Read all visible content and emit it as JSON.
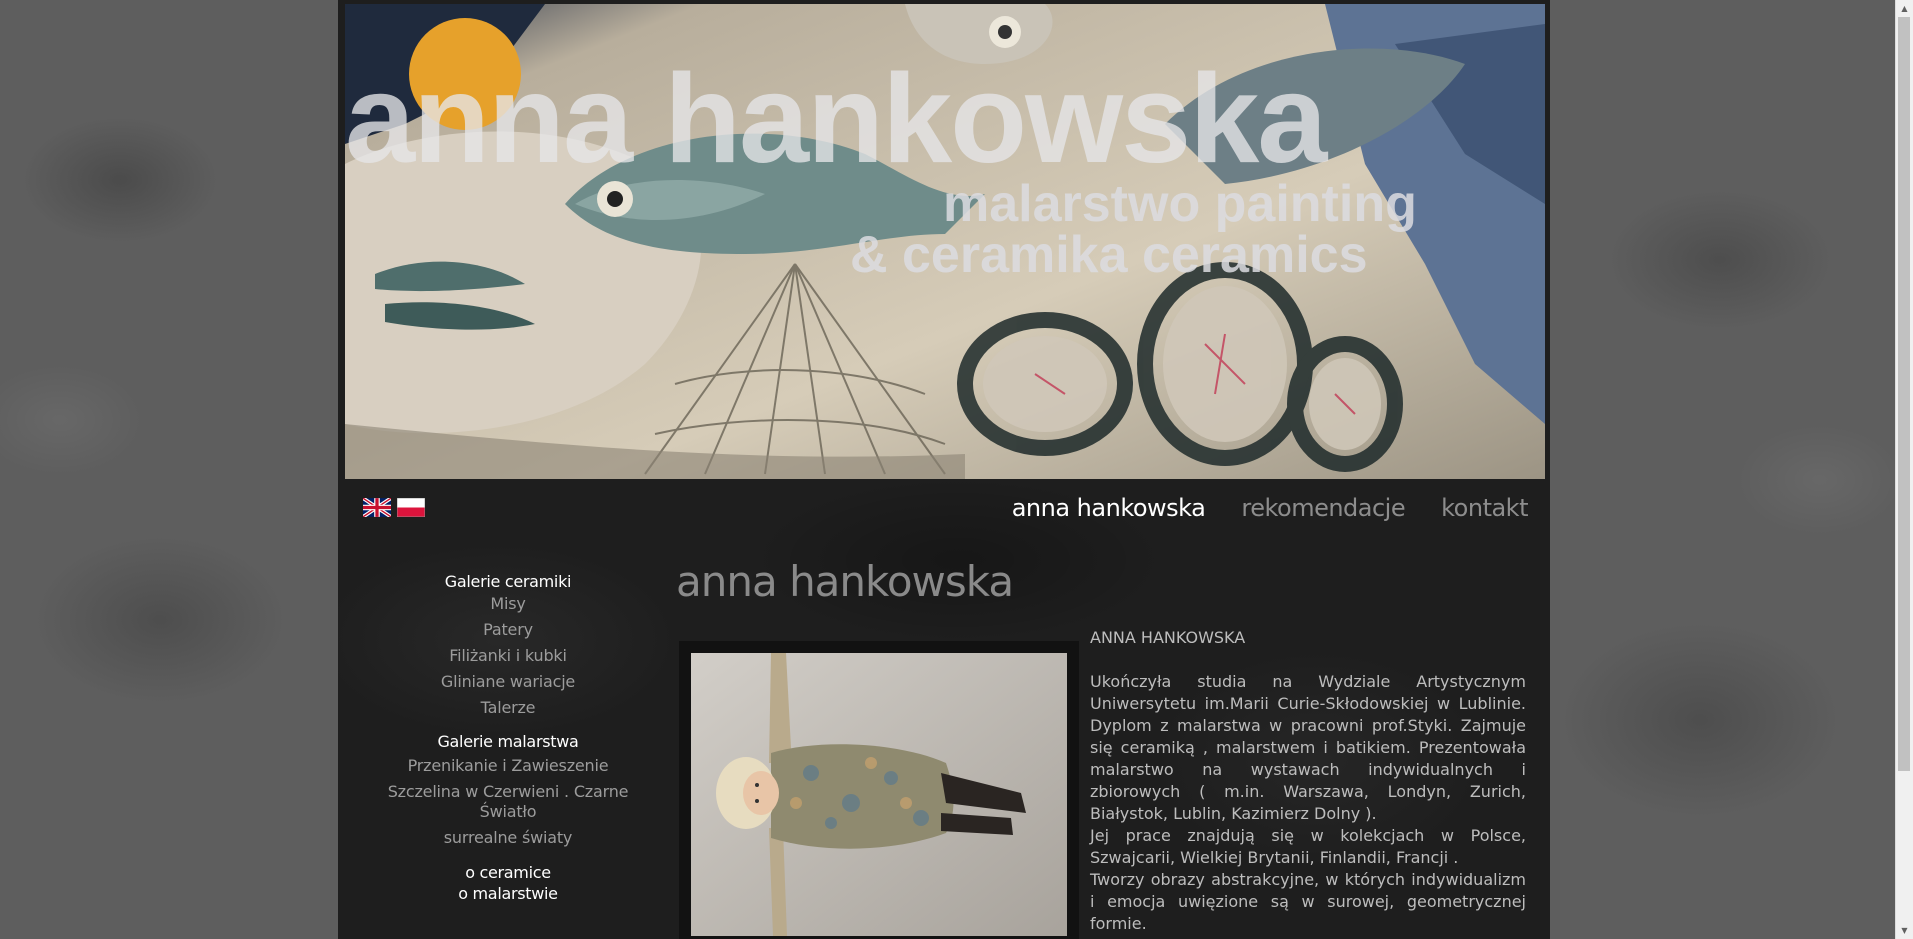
{
  "banner": {
    "title": "anna hankowska",
    "subtitle_line1": "malarstwo painting",
    "subtitle_line2": "& ceramika ceramics"
  },
  "flags": {
    "en": "english-flag-icon",
    "pl": "polish-flag-icon"
  },
  "topnav": {
    "items": [
      {
        "label": "anna hankowska",
        "active": true
      },
      {
        "label": "rekomendacje",
        "active": false
      },
      {
        "label": "kontakt",
        "active": false
      }
    ]
  },
  "sidebar": {
    "ceramics_title": "Galerie ceramiki",
    "ceramics_items": [
      "Misy",
      "Patery",
      "Filiżanki i kubki",
      "Gliniane wariacje",
      "Talerze"
    ],
    "painting_title": "Galerie malarstwa",
    "painting_items": [
      "Przenikanie i Zawieszenie",
      "Szczelina w Czerwieni . Czarne Światło",
      "surrealne światy"
    ],
    "about_ceramics": "o ceramice",
    "about_painting": "o malarstwie"
  },
  "main": {
    "title": "anna hankowska",
    "bio_heading": "ANNA HANKOWSKA",
    "bio_paragraph1": "Ukończyła studia na Wydziale Artystycznym Uniwersytetu im.Marii Curie-Skłodowskiej w Lublinie. Dyplom z malarstwa w pracowni prof.Styki. Zajmuje się ceramiką , malarstwem i batikiem. Prezentowała malarstwo na wystawach indywidualnych i zbiorowych ( m.in. Warszawa, Londyn, Zurich, Białystok, Lublin, Kazimierz Dolny ).",
    "bio_paragraph2": "Jej prace znajdują się w kolekcjach w Polsce, Szwajcarii, Wielkiej Brytanii, Finlandii, Francji .",
    "bio_paragraph3": "Tworzy obrazy abstrakcyjne, w których indywidualizm i emocja uwięzione są w surowej, geometrycznej formie."
  },
  "colors": {
    "page_bg": "#5e5e5e",
    "content_bg": "#1e1e1e",
    "nav_active": "#ffffff",
    "nav_inactive": "#8d8d8d",
    "sidebar_item": "#9c9c9c",
    "body_text": "#bdbdbd"
  }
}
